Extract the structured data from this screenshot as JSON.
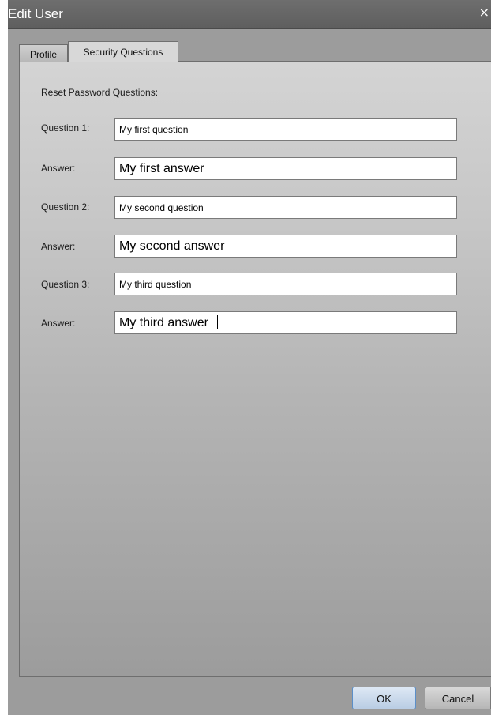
{
  "window": {
    "title": "Edit User",
    "close_glyph": "×"
  },
  "tabs": [
    {
      "label": "Profile",
      "active": false
    },
    {
      "label": "Security Questions",
      "active": true
    }
  ],
  "section": {
    "heading": "Reset Password Questions:"
  },
  "rows": [
    {
      "label": "Question 1:",
      "value": "My first question"
    },
    {
      "label": "Answer:",
      "value": "My first answer"
    },
    {
      "label": "Question 2:",
      "value": "My second question"
    },
    {
      "label": "Answer:",
      "value": "My second answer"
    },
    {
      "label": "Question 3:",
      "value": "My third question"
    },
    {
      "label": "Answer:",
      "value": "My third answer"
    }
  ],
  "buttons": {
    "ok": "OK",
    "cancel": "Cancel"
  },
  "icons": {
    "close": "close-icon"
  },
  "colors": {
    "titlebar": "#666666",
    "panel_top": "#d4d4d4",
    "panel_bottom": "#9c9c9c",
    "ok_accent": "#5b8fc9"
  }
}
